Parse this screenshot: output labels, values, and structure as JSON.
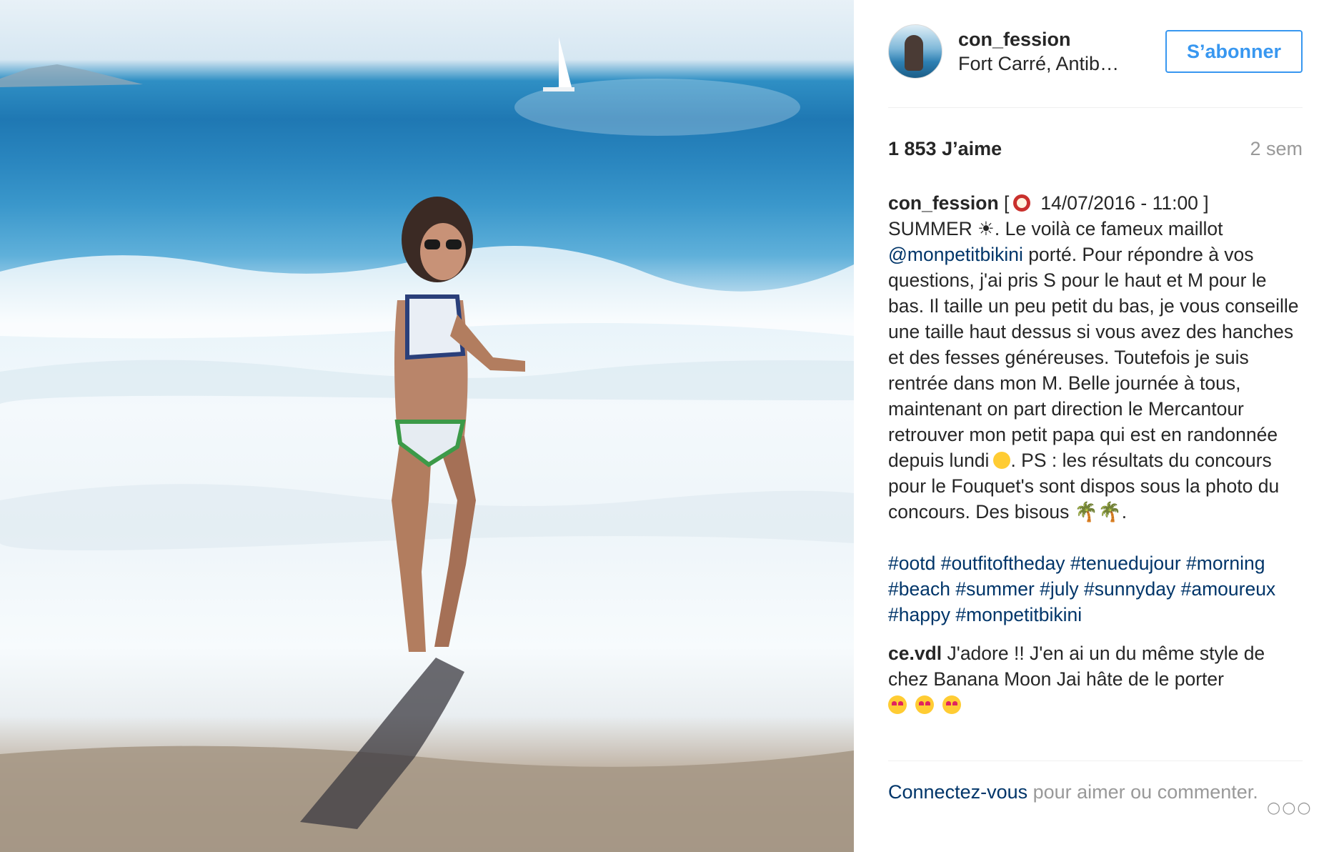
{
  "post": {
    "username": "con_fession",
    "location": "Fort Carré, Antib…",
    "follow_label": "S’abonner",
    "likes": "1 853 J’aime",
    "time_ago": "2 sem"
  },
  "caption": {
    "author": "con_fession",
    "open_bracket": "[",
    "datetime": "14/07/2016 - 11:00 ]",
    "line_summer": "SUMMER ☀. Le voilà ce fameux maillot",
    "mention": "@monpetitbikini",
    "text_after_mention": " porté. Pour répondre à vos questions, j'ai pris S pour le haut et M pour le bas. Il taille un peu petit du bas, je vous conseille une taille haut dessus si vous avez des hanches et des fesses généreuses. Toutefois je suis rentrée dans mon M. Belle journée à tous, maintenant on part direction le Mercantour retrouver mon petit papa qui est en randonnée depuis lundi",
    "text_after_emoji": ". PS : les résultats du concours pour le Fouquet's sont dispos sous la photo du concours. Des bisous 🌴🌴.",
    "hashtags": [
      "#ootd",
      "#outfitoftheday",
      "#tenuedujour",
      "#morning",
      "#beach",
      "#summer",
      "#july",
      "#sunnyday",
      "#amoureux",
      "#happy",
      "#monpetitbikini"
    ]
  },
  "comment": {
    "author": "ce.vdl",
    "text": " J'adore !! J'en ai un du même style de chez Banana Moon Jai hâte de le porter"
  },
  "footer": {
    "login_link": "Connectez-vous",
    "login_text": " pour aimer ou commenter.",
    "more_label": "○○○"
  },
  "icons": {
    "clock": "alarm-clock-icon",
    "kiss": "face-blowing-kiss-icon",
    "heart_eyes": "heart-eyes-face-icon"
  },
  "colors": {
    "follow_blue": "#3897f0",
    "link_blue": "#003569",
    "muted_gray": "#999999"
  }
}
